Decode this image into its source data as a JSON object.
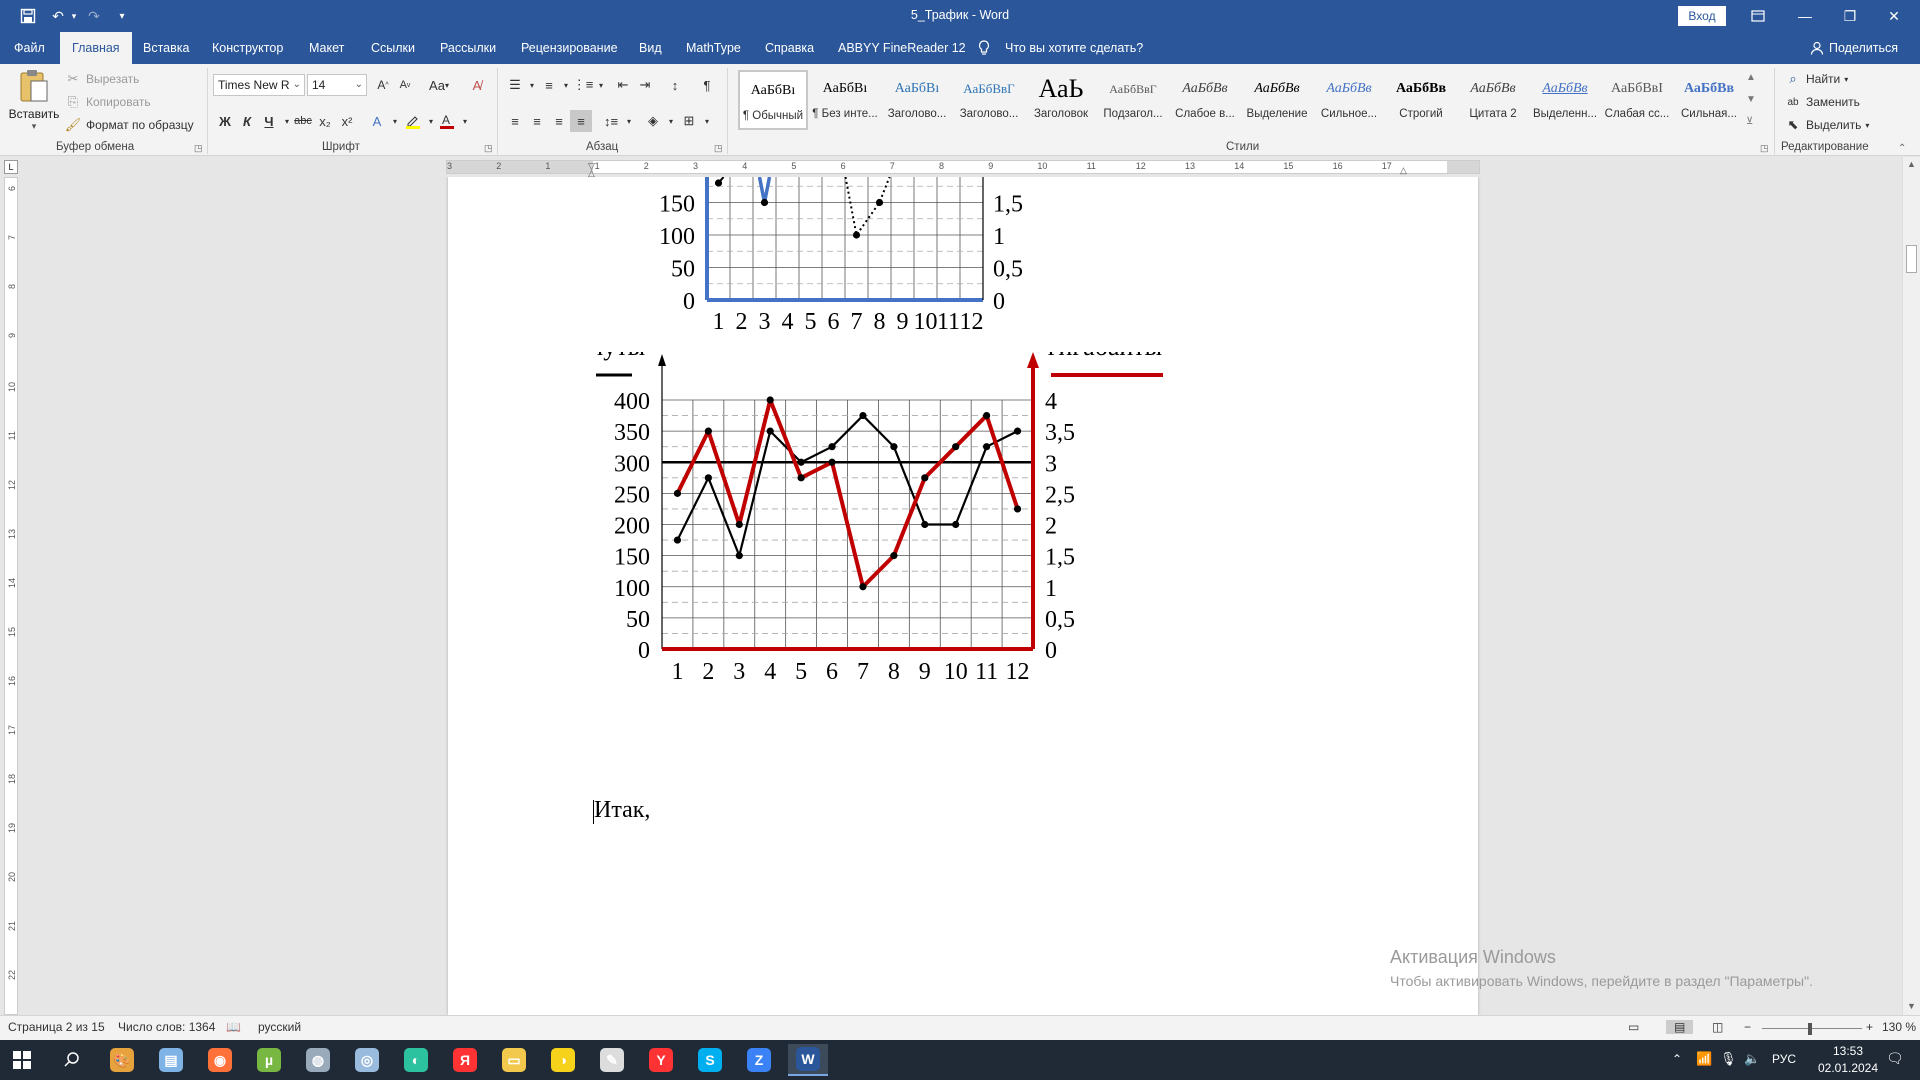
{
  "titlebar": {
    "title": "5_Трафик  -  Word",
    "signin_label": "Вход",
    "colors": {
      "bg": "#2b579a"
    }
  },
  "tabs": [
    {
      "label": "Файл"
    },
    {
      "label": "Главная",
      "active": true
    },
    {
      "label": "Вставка"
    },
    {
      "label": "Конструктор"
    },
    {
      "label": "Макет"
    },
    {
      "label": "Ссылки"
    },
    {
      "label": "Рассылки"
    },
    {
      "label": "Рецензирование"
    },
    {
      "label": "Вид"
    },
    {
      "label": "MathType"
    },
    {
      "label": "Справка"
    },
    {
      "label": "ABBYY FineReader 12"
    }
  ],
  "tell_me": {
    "placeholder": "Что вы хотите сделать?",
    "icon": "lightbulb-icon"
  },
  "share_label": "Поделиться",
  "ribbon": {
    "clipboard": {
      "paste_label": "Вставить",
      "cut_label": "Вырезать",
      "copy_label": "Копировать",
      "format_painter_label": "Формат по образцу",
      "group_label": "Буфер обмена"
    },
    "font": {
      "font_name": "Times New R",
      "font_size": "14",
      "group_label": "Шрифт",
      "change_case": "Aa",
      "bold": "Ж",
      "italic": "К",
      "underline": "Ч",
      "strike": "abc",
      "sub": "x₂",
      "sup": "x²"
    },
    "paragraph": {
      "group_label": "Абзац"
    },
    "styles": {
      "group_label": "Стили",
      "items": [
        {
          "sample": "АаБбВı",
          "name": "¶ Обычный"
        },
        {
          "sample": "АаБбВı",
          "name": "¶ Без инте..."
        },
        {
          "sample": "АаБбВı",
          "name": "Заголово..."
        },
        {
          "sample": "АаБбВвГ",
          "name": "Заголово..."
        },
        {
          "sample": "АаЬ",
          "name": "Заголовок"
        },
        {
          "sample": "АаБбВвГ",
          "name": "Подзагол..."
        },
        {
          "sample": "АаБбВв",
          "name": "Слабое в..."
        },
        {
          "sample": "АаБбВв",
          "name": "Выделение"
        },
        {
          "sample": "АаБбВв",
          "name": "Сильное..."
        },
        {
          "sample": "АаБбВв",
          "name": "Строгий"
        },
        {
          "sample": "АаБбВв",
          "name": "Цитата 2"
        },
        {
          "sample": "АаБбВв",
          "name": "Выделенн..."
        },
        {
          "sample": "АаБбВвІ",
          "name": "Слабая сс..."
        },
        {
          "sample": "АаБбВв",
          "name": "Сильная..."
        }
      ]
    },
    "editing": {
      "find_label": "Найти",
      "replace_label": "Заменить",
      "select_label": "Выделить",
      "group_label": "Редактирование"
    }
  },
  "ruler": {
    "ticks": [
      "3",
      "2",
      "1",
      "1",
      "2",
      "3",
      "4",
      "5",
      "6",
      "7",
      "8",
      "9",
      "10",
      "11",
      "12",
      "13",
      "14",
      "15",
      "16",
      "17"
    ],
    "vticks": [
      "6",
      "7",
      "8",
      "9",
      "10",
      "11",
      "12",
      "13",
      "14",
      "15",
      "16",
      "17",
      "18",
      "19",
      "20",
      "21",
      "22"
    ]
  },
  "document": {
    "body_text": "Итак,",
    "chart_data": [
      {
        "type": "line",
        "partial": true,
        "categories": [
          "1",
          "2",
          "3",
          "4",
          "5",
          "6",
          "7",
          "8",
          "9",
          "10",
          "11",
          "12"
        ],
        "y_left_ticks": [
          "0",
          "50",
          "100",
          "150"
        ],
        "y_right_ticks": [
          "0",
          "0,5",
          "1",
          "1,5"
        ],
        "axis_color": "#4472c4",
        "series": [
          {
            "style": "dotted",
            "color": "#000000",
            "points": [
              {
                "x": 7,
                "y": 100
              },
              {
                "x": 8,
                "y": 150
              }
            ]
          },
          {
            "style": "solid",
            "color": "#4472c4",
            "points": [
              {
                "x": 3,
                "y": 150
              }
            ]
          },
          {
            "style": "solid",
            "color": "#000000",
            "points": [
              {
                "x": 1,
                "y": 180
              }
            ]
          }
        ]
      },
      {
        "type": "line",
        "categories": [
          "1",
          "2",
          "3",
          "4",
          "5",
          "6",
          "7",
          "8",
          "9",
          "10",
          "11",
          "12"
        ],
        "ylabel": "минуты",
        "ylabel_right": "гигабайты",
        "ylim": [
          0,
          400
        ],
        "ylim_right": [
          0,
          4
        ],
        "y_left_ticks": [
          "0",
          "50",
          "100",
          "150",
          "200",
          "250",
          "300",
          "350",
          "400"
        ],
        "y_right_ticks": [
          "0",
          "0,5",
          "1",
          "1,5",
          "2",
          "2,5",
          "3",
          "3,5",
          "4"
        ],
        "reference_line": 300,
        "grid": true,
        "series": [
          {
            "axis": "left",
            "color": "#000000",
            "values": [
              175,
              275,
              150,
              350,
              300,
              325,
              375,
              325,
              200,
              200,
              325,
              350
            ]
          },
          {
            "axis": "right",
            "color": "#c00000",
            "values": [
              2.5,
              3.5,
              2.0,
              4.0,
              2.75,
              3.0,
              1.0,
              1.5,
              2.75,
              3.25,
              3.75,
              2.25
            ]
          }
        ]
      }
    ]
  },
  "watermark": {
    "title": "Активация Windows",
    "subtitle": "Чтобы активировать Windows, перейдите в раздел \"Параметры\"."
  },
  "statusbar": {
    "page": "Страница 2 из 15",
    "words": "Число слов: 1364",
    "language": "русский",
    "zoom": "130 %"
  },
  "taskbar": {
    "lang": "РУС",
    "time": "13:53",
    "date": "02.01.2024",
    "apps": [
      "paint-icon",
      "notepad-icon",
      "firefox-icon",
      "utorrent-icon",
      "app-icon",
      "app2-icon",
      "edge-icon",
      "yandex-icon",
      "explorer-icon",
      "beeline-icon",
      "tools-icon",
      "yandex-browser-icon",
      "skype-icon",
      "z-app-icon",
      "word-icon"
    ]
  }
}
